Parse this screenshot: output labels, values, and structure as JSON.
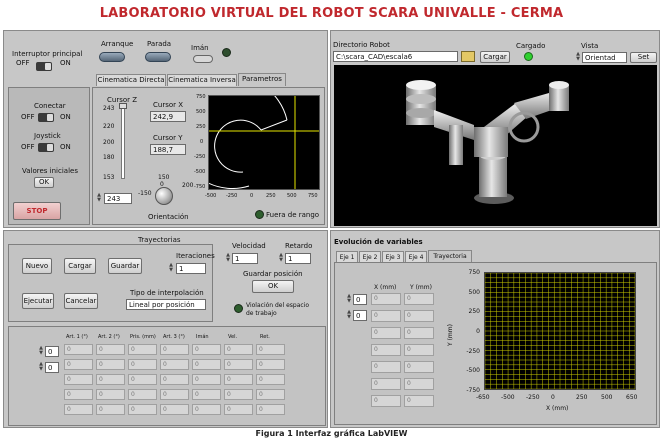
{
  "title": "LABORATORIO VIRTUAL DEL ROBOT SCARA UNIVALLE - CERMA",
  "caption": "Figura 1 Interfaz gráfica LabVIEW",
  "top": {
    "main_switch_label": "Interruptor principal",
    "off_label": "OFF",
    "on_label": "ON",
    "arranque_label": "Arranque",
    "parada_label": "Parada",
    "iman_label": "Imán"
  },
  "tabs": [
    "Cinematica Directa",
    "Cinematica Inversa",
    "Parametros"
  ],
  "left_controls": {
    "conectar_label": "Conectar",
    "joystick_label": "Joystick",
    "off": "OFF",
    "on": "ON",
    "valores_label": "Valores iniciales",
    "ok_label": "OK",
    "stop_label": "STOP"
  },
  "cursor": {
    "cursor_z_label": "Cursor Z",
    "z_ticks": [
      "243",
      "220",
      "200",
      "180",
      "153"
    ],
    "z_value": "243",
    "cursor_x_label": "Cursor X",
    "cursor_x_value": "242,9",
    "cursor_y_label": "Cursor Y",
    "cursor_y_value": "188,7",
    "knob_ticks": [
      "0",
      "150",
      "-150",
      "200"
    ],
    "knob_top": "150",
    "orientacion_label": "Orientación",
    "fuera_label": "Fuera de rango"
  },
  "workspace_plot": {
    "y_ticks": [
      "750",
      "500",
      "250",
      "0",
      "-250",
      "-500",
      "-750"
    ],
    "x_ticks": [
      "-500",
      "-250",
      "0",
      "250",
      "500",
      "750"
    ]
  },
  "directory": {
    "label": "Directorio Robot",
    "path": "C:\\scara_CAD\\escala6",
    "cargar_label": "Cargar",
    "cargado_label": "Cargado",
    "vista_label": "Vista",
    "vista_value": "Orientad",
    "set_label": "Set"
  },
  "trajectories": {
    "title": "Trayectorias",
    "nuevo": "Nuevo",
    "cargar": "Cargar",
    "guardar": "Guardar",
    "ejecutar": "Ejecutar",
    "cancelar": "Cancelar",
    "iteraciones_label": "Iteraciones",
    "iteraciones_value": "1",
    "tipo_label": "Tipo de interpolación",
    "tipo_value": "Lineal por posición",
    "velocidad_label": "Velocidad",
    "velocidad_value": "1",
    "retardo_label": "Retardo",
    "retardo_value": "1",
    "guardar_pos_label": "Guardar posición",
    "ok_label": "OK",
    "violacion_label": "Violación del espacio de trabajo"
  },
  "table": {
    "index_values": [
      "0",
      "0"
    ],
    "headers": [
      "Art. 1 (°)",
      "Art. 2 (°)",
      "Pris. (mm)",
      "Art. 3 (°)",
      "Imán",
      "Vel.",
      "Ret."
    ],
    "rows": [
      [
        "0",
        "0",
        "0",
        "0",
        "0",
        "0",
        "0"
      ],
      [
        "0",
        "0",
        "0",
        "0",
        "0",
        "0",
        "0"
      ],
      [
        "0",
        "0",
        "0",
        "0",
        "0",
        "0",
        "0"
      ],
      [
        "0",
        "0",
        "0",
        "0",
        "0",
        "0",
        "0"
      ],
      [
        "0",
        "0",
        "0",
        "0",
        "0",
        "0",
        "0"
      ]
    ]
  },
  "evolution": {
    "title": "Evolución de variables",
    "tabs": [
      "Eje 1",
      "Eje 2",
      "Eje 3",
      "Eje 4",
      "Trayectoria"
    ],
    "index_values": [
      "0",
      "0"
    ],
    "col_x": "X (mm)",
    "col_y": "Y (mm)",
    "rows": [
      [
        "0",
        "0"
      ],
      [
        "0",
        "0"
      ],
      [
        "0",
        "0"
      ],
      [
        "0",
        "0"
      ],
      [
        "0",
        "0"
      ],
      [
        "0",
        "0"
      ],
      [
        "0",
        "0"
      ]
    ],
    "y_axis_label": "Y (mm)",
    "x_axis_label": "X (mm)",
    "y_ticks": [
      "750",
      "500",
      "250",
      "0",
      "-250",
      "-500",
      "-750"
    ],
    "x_ticks": [
      "-650",
      "-500",
      "-250",
      "0",
      "250",
      "500",
      "650"
    ]
  },
  "colors": {
    "title_red": "#c0282d",
    "plot_bg": "#000000",
    "grid_yellow": "#c8c800",
    "led_green": "#2fd02f"
  }
}
